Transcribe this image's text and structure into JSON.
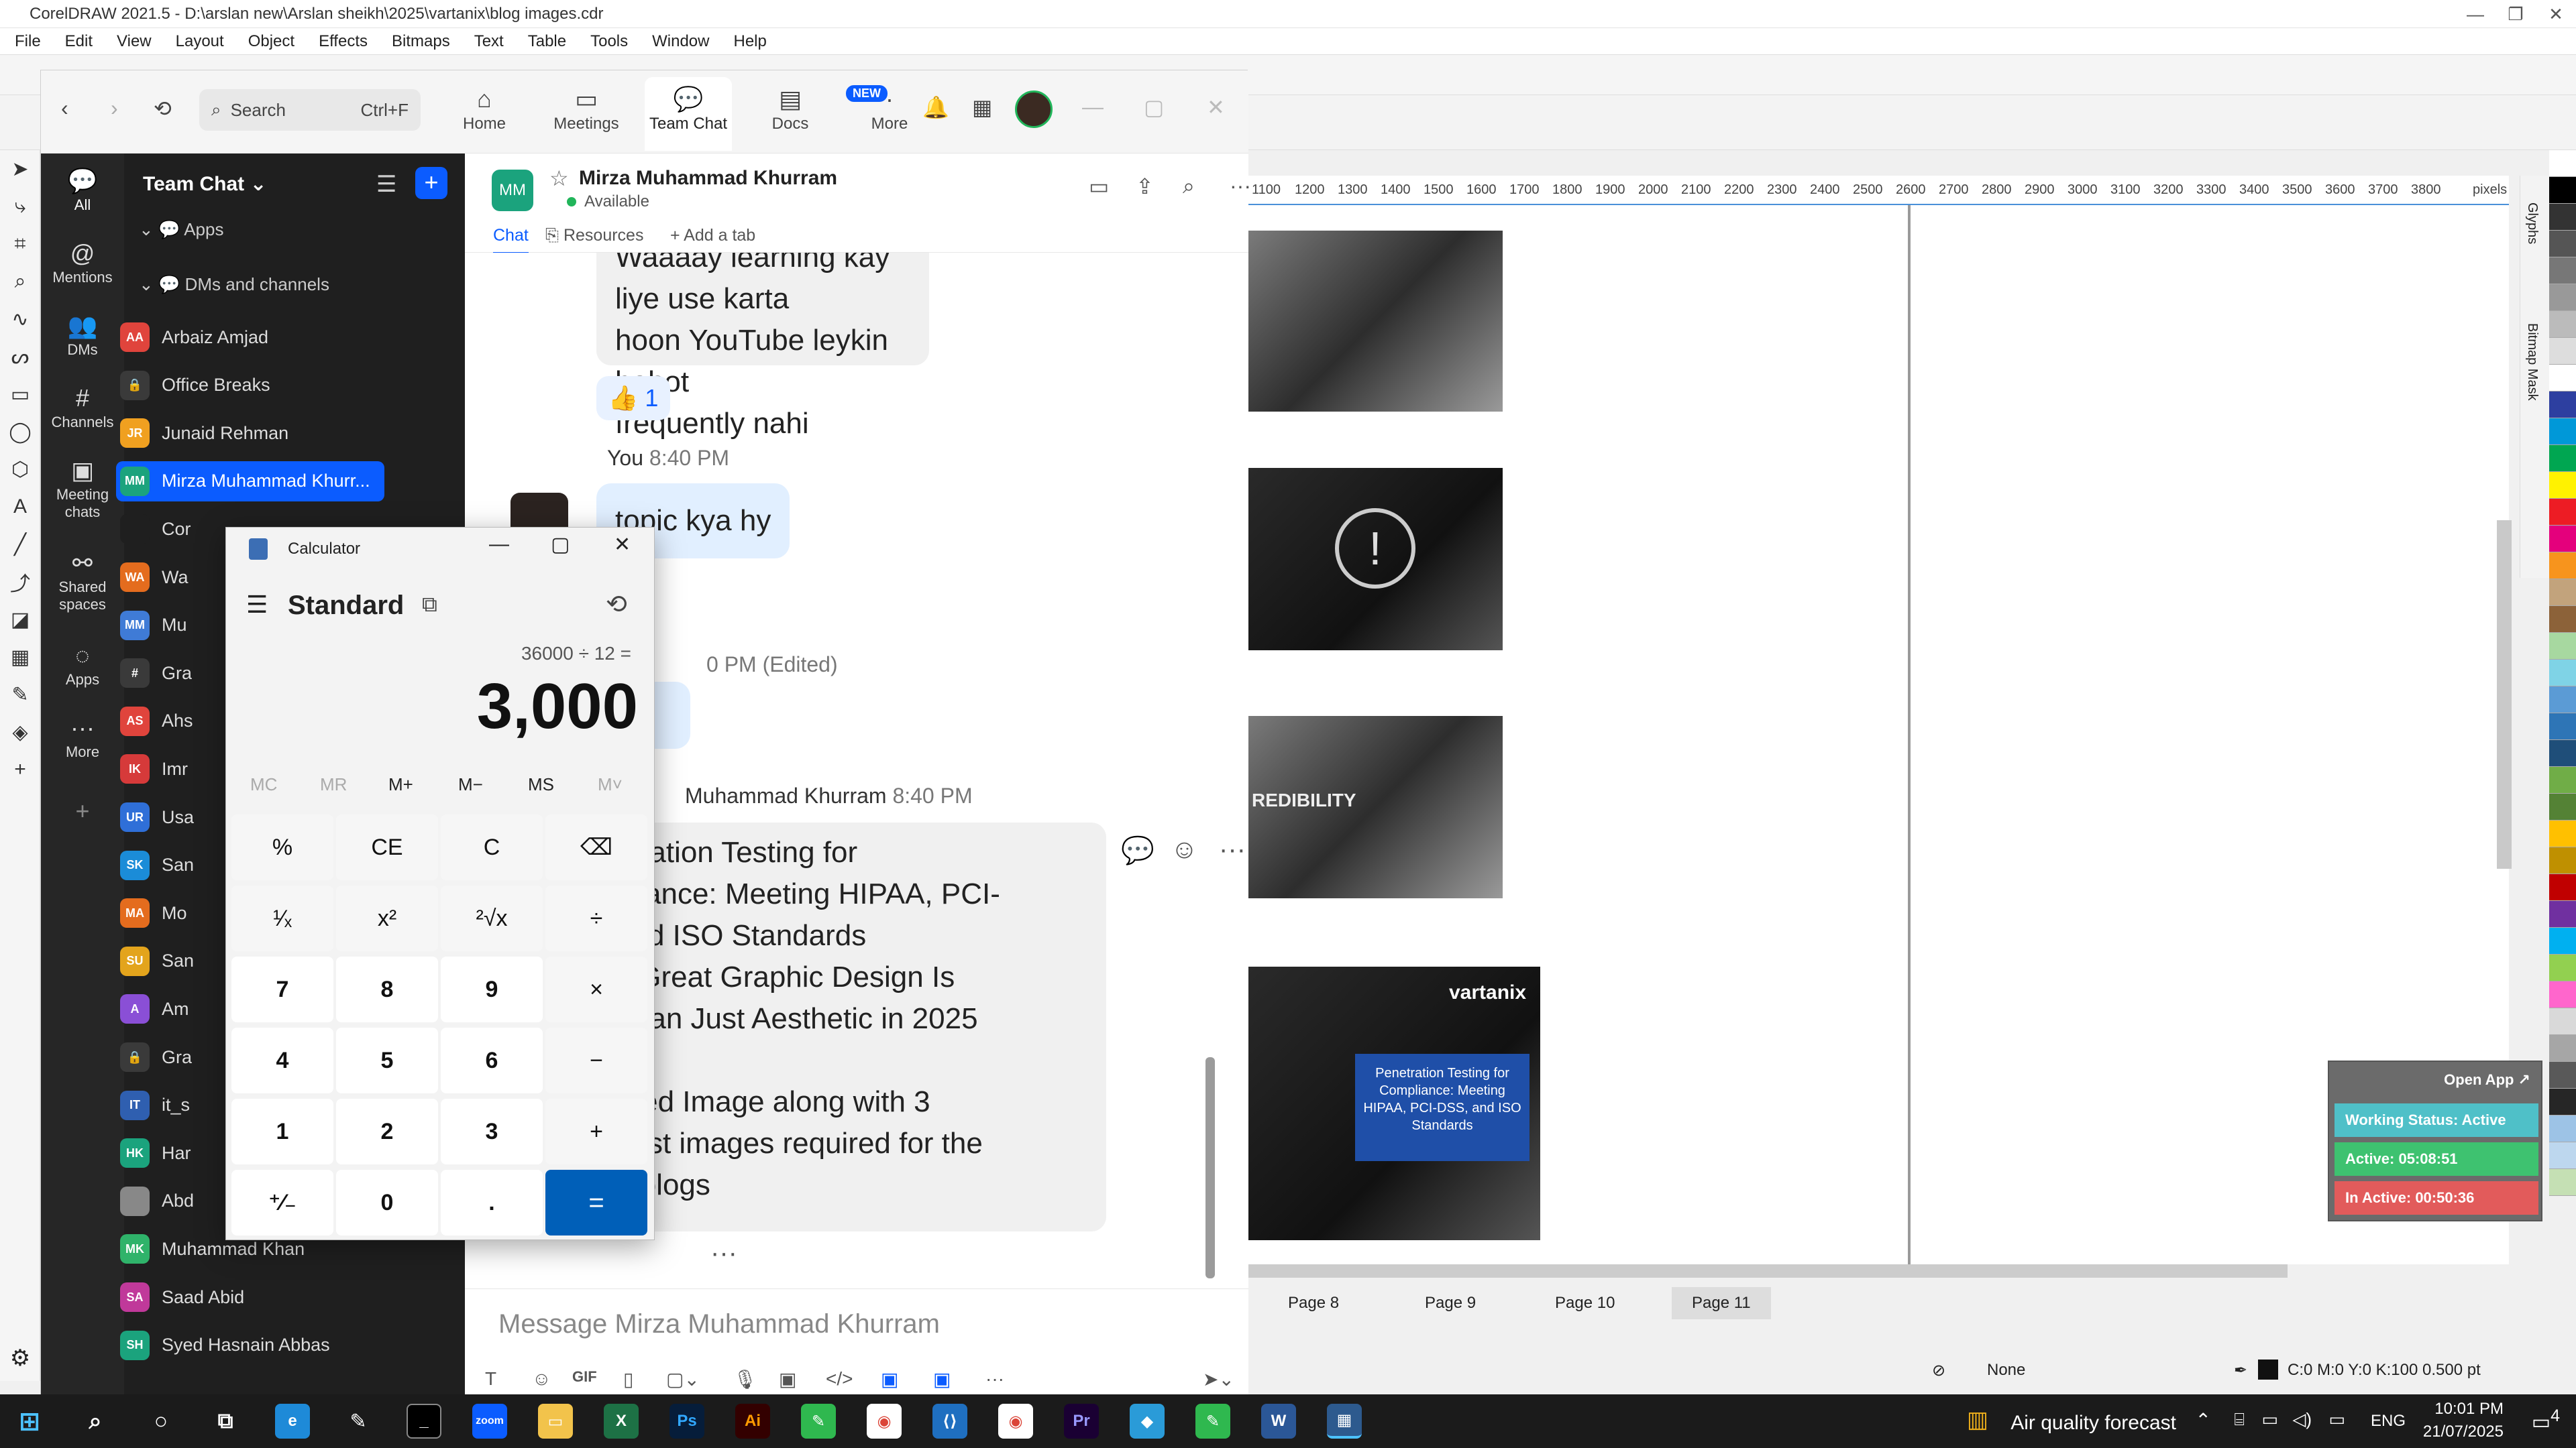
{
  "coreldraw": {
    "title": "CorelDRAW 2021.5 - D:\\arslan new\\Arslan sheikh\\2025\\vartanix\\blog images.cdr",
    "menu": [
      "File",
      "Edit",
      "View",
      "Layout",
      "Object",
      "Effects",
      "Bitmaps",
      "Text",
      "Table",
      "Tools",
      "Window",
      "Help"
    ],
    "ruler_ticks": [
      "1100",
      "1200",
      "1300",
      "1400",
      "1500",
      "1600",
      "1700",
      "1800",
      "1900",
      "2000",
      "2100",
      "2200",
      "2300",
      "2400",
      "2500",
      "2600",
      "2700",
      "2800",
      "2900",
      "3000",
      "3100",
      "3200",
      "3300",
      "3400",
      "3500",
      "3600",
      "3700",
      "3800"
    ],
    "ruler_unit": "pixels",
    "docker_tabs": [
      "Glyphs",
      "Bitmap Mask"
    ],
    "page_tabs": [
      "Page 8",
      "Page 9",
      "Page 10",
      "Page 11"
    ],
    "active_page": "Page 11",
    "fill_label": "None",
    "outline_label": "C:0 M:0 Y:0 K:100  0.500 pt",
    "blog_card": {
      "brand": "vartanix",
      "text": "Penetration Testing for Compliance: Meeting HIPAA, PCI-DSS, and ISO Standards"
    },
    "credibility_text": "REDIBILITY",
    "palette": [
      "#ffffff",
      "#000000",
      "#333333",
      "#555555",
      "#777777",
      "#999999",
      "#bbbbbb",
      "#dddddd",
      "#ffffff",
      "#2d3fa0",
      "#0098d8",
      "#00a651",
      "#fff200",
      "#ed1c24",
      "#e4007c",
      "#f7941d",
      "#c2a37c",
      "#8c6239",
      "#a7d8a0",
      "#7fd3e6",
      "#5b9bd5",
      "#2e75b6",
      "#1f4e79",
      "#70ad47",
      "#548235",
      "#ffc000",
      "#bf9000",
      "#c00000",
      "#7030a0",
      "#00b0f0",
      "#92d050",
      "#ff66cc",
      "#d9d9d9",
      "#a6a6a6",
      "#595959",
      "#262626",
      "#9dc3e6",
      "#bdd7ee",
      "#c5e0b4"
    ]
  },
  "work_status": {
    "open_app": "Open App ↗",
    "status": "Working Status: Active",
    "active": "Active: 05:08:51",
    "inactive": "In Active: 00:50:36",
    "colors": {
      "status": "#4fc0c8",
      "active": "#3ec270",
      "inactive": "#e25b5b"
    }
  },
  "zoom": {
    "search": {
      "label": "Search",
      "shortcut": "Ctrl+F"
    },
    "nav": [
      {
        "label": "Home",
        "icon": "home-icon"
      },
      {
        "label": "Meetings",
        "icon": "video-icon"
      },
      {
        "label": "Team Chat",
        "icon": "chat-icon"
      },
      {
        "label": "Docs",
        "icon": "doc-icon"
      },
      {
        "label": "More",
        "icon": "more-icon"
      }
    ],
    "new_badge": "NEW",
    "rail": [
      {
        "label": "All",
        "icon": "chat-bubble-icon"
      },
      {
        "label": "Mentions",
        "icon": "at-icon"
      },
      {
        "label": "DMs",
        "icon": "people-icon"
      },
      {
        "label": "Channels",
        "icon": "hash-icon"
      },
      {
        "label": "Meeting chats",
        "icon": "calendar-icon"
      },
      {
        "label": "Shared spaces",
        "icon": "share-icon"
      },
      {
        "label": "Apps",
        "icon": "apps-icon"
      },
      {
        "label": "More",
        "icon": "ellipsis-icon"
      }
    ],
    "list": {
      "header": "Team Chat",
      "apps_section": "Apps",
      "dm_section": "DMs and channels",
      "items": [
        {
          "label": "Arbaiz Amjad",
          "initials": "AA",
          "color": "#e0443c"
        },
        {
          "label": "Office Breaks",
          "initials": "🔒",
          "color": "#3a3a3a"
        },
        {
          "label": "Junaid Rehman",
          "initials": "JR",
          "color": "#f0a020"
        },
        {
          "label": "Mirza Muhammad Khurr...",
          "initials": "MM",
          "color": "#1ba37d"
        },
        {
          "label": "Cor",
          "initials": "",
          "color": "#1f1f1f"
        },
        {
          "label": "Wa",
          "initials": "WA",
          "color": "#e46c1e"
        },
        {
          "label": "Mu",
          "initials": "MM",
          "color": "#3f7bd6"
        },
        {
          "label": "Gra",
          "initials": "#",
          "color": "#3a3a3a"
        },
        {
          "label": "Ahs",
          "initials": "AS",
          "color": "#e0443c"
        },
        {
          "label": "Imr",
          "initials": "IK",
          "color": "#d63a3a"
        },
        {
          "label": "Usa",
          "initials": "UR",
          "color": "#2f6fd8"
        },
        {
          "label": "San",
          "initials": "SK",
          "color": "#1b8cd8"
        },
        {
          "label": "Mo",
          "initials": "MA",
          "color": "#e46c1e"
        },
        {
          "label": "San",
          "initials": "SU",
          "color": "#e3a41c"
        },
        {
          "label": "Am",
          "initials": "A",
          "color": "#8a4fd6"
        },
        {
          "label": "Gra",
          "initials": "🔒",
          "color": "#3a3a3a"
        },
        {
          "label": "it_s",
          "initials": "IT",
          "color": "#2f5fb0"
        },
        {
          "label": "Har",
          "initials": "HK",
          "color": "#1ba37d"
        },
        {
          "label": "Abd",
          "initials": "",
          "color": "#888888"
        },
        {
          "label": "Muhammad Khan",
          "initials": "MK",
          "color": "#2fb36a"
        },
        {
          "label": "Saad Abid",
          "initials": "SA",
          "color": "#c0399a"
        },
        {
          "label": "Syed Hasnain Abbas",
          "initials": "SH",
          "color": "#1ba37d"
        }
      ]
    },
    "chat": {
      "name": "Mirza Muhammad Khurram",
      "initials": "MM",
      "status": "Available",
      "tabs": [
        "Chat",
        "Resources",
        "+ Add a tab"
      ],
      "messages": [
        {
          "line1": "Waaaay learning kay liye use karta",
          "line2": "hoon YouTube leykin bohot",
          "line3": "frequently nahi"
        },
        {
          "reaction": "👍 1"
        },
        {
          "sender": "You",
          "time": "8:40 PM",
          "text": "topic kya hy"
        },
        {
          "time_edited": "0 PM (Edited)"
        },
        {
          "sender": "Muhammad Khurram",
          "time": "8:40 PM",
          "lines": [
            "etration Testing for",
            "pliance: Meeting HIPAA, PCI-",
            " and ISO Standards",
            "y Great Graphic Design Is",
            " Than Just Aesthetic in 2025",
            "",
            "ured Image along with 3",
            "post images required for the",
            " 2 blogs"
          ]
        }
      ],
      "input_placeholder": "Message Mirza Muhammad Khurram"
    }
  },
  "calculator": {
    "title": "Calculator",
    "mode": "Standard",
    "expression": "36000 ÷ 12 =",
    "result": "3,000",
    "memory": [
      "MC",
      "MR",
      "M+",
      "M−",
      "MS",
      "M˅"
    ],
    "keys": [
      [
        "%",
        "CE",
        "C",
        "⌫"
      ],
      [
        "¹⁄ₓ",
        "x²",
        "²√x",
        "÷"
      ],
      [
        "7",
        "8",
        "9",
        "×"
      ],
      [
        "4",
        "5",
        "6",
        "−"
      ],
      [
        "1",
        "2",
        "3",
        "+"
      ],
      [
        "⁺⁄₋",
        "0",
        ".",
        "="
      ]
    ]
  },
  "taskbar": {
    "weather": "Air quality forecast",
    "lang": "ENG",
    "time": "10:01 PM",
    "date": "21/07/2025",
    "notif_count": "4"
  }
}
